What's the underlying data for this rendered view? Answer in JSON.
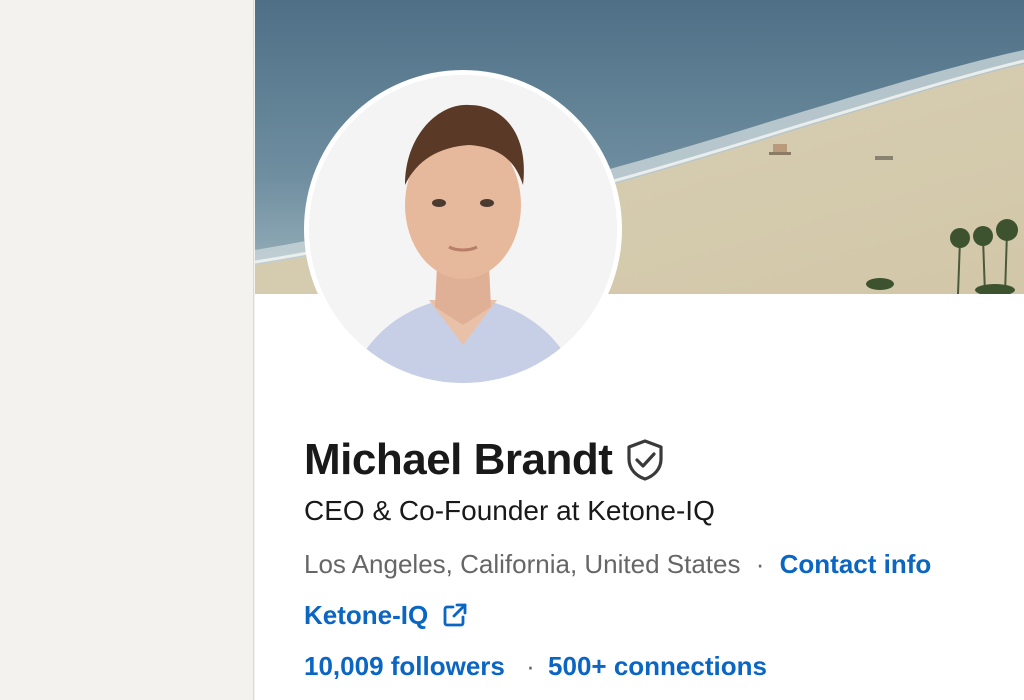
{
  "profile": {
    "name": "Michael Brandt",
    "headline": "CEO & Co-Founder at Ketone-IQ",
    "location": "Los Angeles, California, United States",
    "separator": "·",
    "contact_info_label": "Contact info",
    "website_label": "Ketone-IQ",
    "followers_label": "10,009 followers",
    "connections_label": "500+ connections"
  },
  "icons": {
    "verified": "verified-shield-icon",
    "external_link": "external-link-icon"
  },
  "colors": {
    "link": "#0a66c2",
    "text_primary": "#191919",
    "text_secondary": "#666666",
    "background": "#f3f2ef"
  }
}
